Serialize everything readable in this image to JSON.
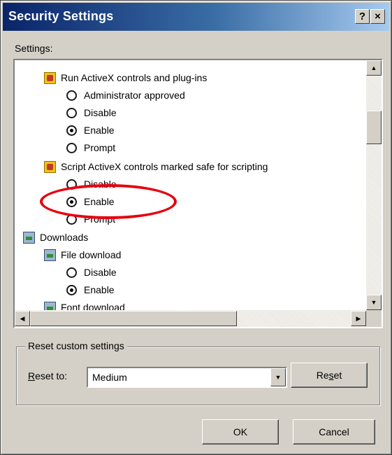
{
  "window": {
    "title": "Security Settings",
    "help_glyph": "?",
    "close_glyph": "×"
  },
  "settings_label": "Settings:",
  "tree": {
    "items": [
      {
        "type": "category",
        "icon": "shield-icon",
        "label": "Run ActiveX controls and plug-ins"
      },
      {
        "type": "radio",
        "label": "Administrator approved",
        "checked": false
      },
      {
        "type": "radio",
        "label": "Disable",
        "checked": false
      },
      {
        "type": "radio",
        "label": "Enable",
        "checked": true
      },
      {
        "type": "radio",
        "label": "Prompt",
        "checked": false
      },
      {
        "type": "category",
        "icon": "shield-icon",
        "label": "Script ActiveX controls marked safe for scripting"
      },
      {
        "type": "radio",
        "label": "Disable",
        "checked": false
      },
      {
        "type": "radio",
        "label": "Enable",
        "checked": true
      },
      {
        "type": "radio",
        "label": "Prompt",
        "checked": false
      },
      {
        "type": "category",
        "icon": "download-icon",
        "label": "Downloads"
      },
      {
        "type": "subcategory",
        "icon": "download-icon",
        "label": "File download"
      },
      {
        "type": "radio",
        "label": "Disable",
        "checked": false
      },
      {
        "type": "radio",
        "label": "Enable",
        "checked": true
      },
      {
        "type": "subcategory",
        "icon": "download-icon",
        "label": "Font download"
      }
    ]
  },
  "reset_group": {
    "legend": "Reset custom settings",
    "reset_to_label_first": "R",
    "reset_to_label_rest": "eset to:",
    "selected_level": "Medium",
    "reset_button_pre": "Re",
    "reset_button_ul": "s",
    "reset_button_post": "et"
  },
  "buttons": {
    "ok": "OK",
    "cancel": "Cancel"
  },
  "colors": {
    "highlight_ellipse": "#e6000f",
    "title_bar_start": "#0a246a",
    "dialog_face": "#d4d0c8"
  }
}
